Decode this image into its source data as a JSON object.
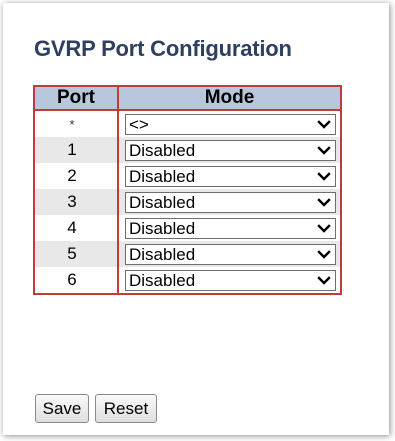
{
  "page": {
    "title": "GVRP Port Configuration"
  },
  "table": {
    "headers": {
      "port": "Port",
      "mode": "Mode"
    },
    "rows": [
      {
        "port": "*",
        "mode": "<>"
      },
      {
        "port": "1",
        "mode": "Disabled"
      },
      {
        "port": "2",
        "mode": "Disabled"
      },
      {
        "port": "3",
        "mode": "Disabled"
      },
      {
        "port": "4",
        "mode": "Disabled"
      },
      {
        "port": "5",
        "mode": "Disabled"
      },
      {
        "port": "6",
        "mode": "Disabled"
      }
    ]
  },
  "buttons": {
    "save_label": "Save",
    "reset_label": "Reset"
  },
  "colors": {
    "title": "#2f3f5f",
    "header_bg": "#b9c7dc",
    "table_border": "#c23a3a",
    "row_alt_bg": "#e8e8e8"
  },
  "icons": {
    "dropdown": "chevron-down-icon"
  }
}
